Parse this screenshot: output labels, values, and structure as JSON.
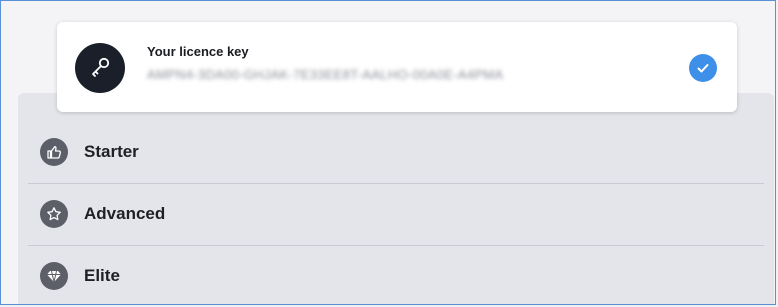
{
  "licence": {
    "title": "Your licence key",
    "key": "AMPN4-3DA00-GHJAK-7E33EE8T-AALHO-00A0E-A4PMA",
    "status_icon": "check-circle-icon",
    "key_icon": "key-icon"
  },
  "plans": [
    {
      "label": "Starter",
      "icon": "thumbs-up-icon"
    },
    {
      "label": "Advanced",
      "icon": "star-icon"
    },
    {
      "label": "Elite",
      "icon": "diamond-icon"
    }
  ],
  "colors": {
    "accent": "#3d8fe8",
    "icon_dark": "#1b1f2a",
    "badge": "#5c5f67",
    "frame_border": "#5b8fd6"
  }
}
